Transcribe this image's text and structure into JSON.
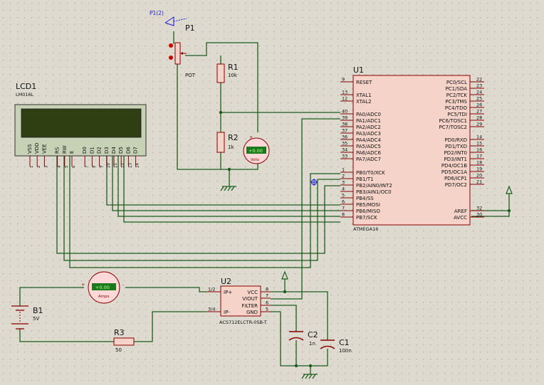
{
  "probe": {
    "label": "P1(2)"
  },
  "pot": {
    "ref": "P1",
    "value": "POT"
  },
  "r1": {
    "ref": "R1",
    "value": "10k"
  },
  "r2": {
    "ref": "R2",
    "value": "1k"
  },
  "voltmeter": {
    "reading": "+0.00",
    "unit": "Volts"
  },
  "ammeter": {
    "reading": "+0.00",
    "unit": "Amps"
  },
  "lcd": {
    "ref": "LCD1",
    "part": "LM016L",
    "pins": [
      "VSS",
      "VDD",
      "VEE",
      "RS",
      "RW",
      "E",
      "D0",
      "D1",
      "D2",
      "D3",
      "D4",
      "D5",
      "D6",
      "D7"
    ],
    "pin_numbers": [
      "1",
      "2",
      "3",
      "4",
      "5",
      "6",
      "7",
      "8",
      "9",
      "10",
      "11",
      "12",
      "13",
      "14"
    ]
  },
  "mcu": {
    "ref": "U1",
    "part": "ATMEGA16",
    "left_pins": [
      {
        "num": "9",
        "name": "RESET"
      },
      {
        "num": "13",
        "name": "XTAL1"
      },
      {
        "num": "12",
        "name": "XTAL2"
      },
      {
        "num": "40",
        "name": "PA0/ADC0"
      },
      {
        "num": "39",
        "name": "PA1/ADC1"
      },
      {
        "num": "38",
        "name": "PA2/ADC2"
      },
      {
        "num": "37",
        "name": "PA3/ADC3"
      },
      {
        "num": "36",
        "name": "PA4/ADC4"
      },
      {
        "num": "35",
        "name": "PA5/ADC5"
      },
      {
        "num": "34",
        "name": "PA6/ADC6"
      },
      {
        "num": "33",
        "name": "PA7/ADC7"
      },
      {
        "num": "1",
        "name": "PB0/T0/XCK"
      },
      {
        "num": "2",
        "name": "PB1/T1"
      },
      {
        "num": "3",
        "name": "PB2/AIN0/INT2"
      },
      {
        "num": "4",
        "name": "PB3/AIN1/OC0"
      },
      {
        "num": "5",
        "name": "PB4/SS"
      },
      {
        "num": "6",
        "name": "PB5/MOSI"
      },
      {
        "num": "7",
        "name": "PB6/MISO"
      },
      {
        "num": "8",
        "name": "PB7/SCK"
      }
    ],
    "right_pins": [
      {
        "num": "22",
        "name": "PC0/SCL"
      },
      {
        "num": "23",
        "name": "PC1/SDA"
      },
      {
        "num": "24",
        "name": "PC2/TCK"
      },
      {
        "num": "25",
        "name": "PC3/TMS"
      },
      {
        "num": "26",
        "name": "PC4/TDO"
      },
      {
        "num": "27",
        "name": "PC5/TDI"
      },
      {
        "num": "28",
        "name": "PC6/TOSC1"
      },
      {
        "num": "29",
        "name": "PC7/TOSC2"
      },
      {
        "num": "14",
        "name": "PD0/RXD"
      },
      {
        "num": "15",
        "name": "PD1/TXD"
      },
      {
        "num": "16",
        "name": "PD2/INT0"
      },
      {
        "num": "17",
        "name": "PD3/INT1"
      },
      {
        "num": "18",
        "name": "PD4/OC1B"
      },
      {
        "num": "19",
        "name": "PD5/OC1A"
      },
      {
        "num": "20",
        "name": "PD6/ICP1"
      },
      {
        "num": "21",
        "name": "PD7/OC2"
      },
      {
        "num": "32",
        "name": "AREF"
      },
      {
        "num": "30",
        "name": "AVCC"
      }
    ]
  },
  "sensor": {
    "ref": "U2",
    "part": "ACS712ELCTR-05B-T",
    "left_pins": [
      {
        "num": "1/2",
        "name": "IP+"
      },
      {
        "num": "3/4",
        "name": "IP-"
      }
    ],
    "right_pins": [
      {
        "num": "8",
        "name": "VCC"
      },
      {
        "num": "7",
        "name": "VIOUT"
      },
      {
        "num": "6",
        "name": "FILTER"
      },
      {
        "num": "5",
        "name": "GND"
      }
    ]
  },
  "b1": {
    "ref": "B1",
    "value": "5V"
  },
  "r3": {
    "ref": "R3",
    "value": "50"
  },
  "c2": {
    "ref": "C2",
    "value": "1n"
  },
  "c1": {
    "ref": "C1",
    "value": "100n"
  },
  "colors": {
    "background": "#dedad0",
    "grid_dot": "#a8a49a",
    "wire": "#1c5e1c",
    "component": "#8b0000",
    "body": "#f5d3c8",
    "lcd_frame": "#c6d1b6",
    "lcd_screen": "#2f3f12",
    "meter_body": "#ffd8d8",
    "meter_display": "#1c7a1c",
    "probe": "#1a1acc"
  }
}
